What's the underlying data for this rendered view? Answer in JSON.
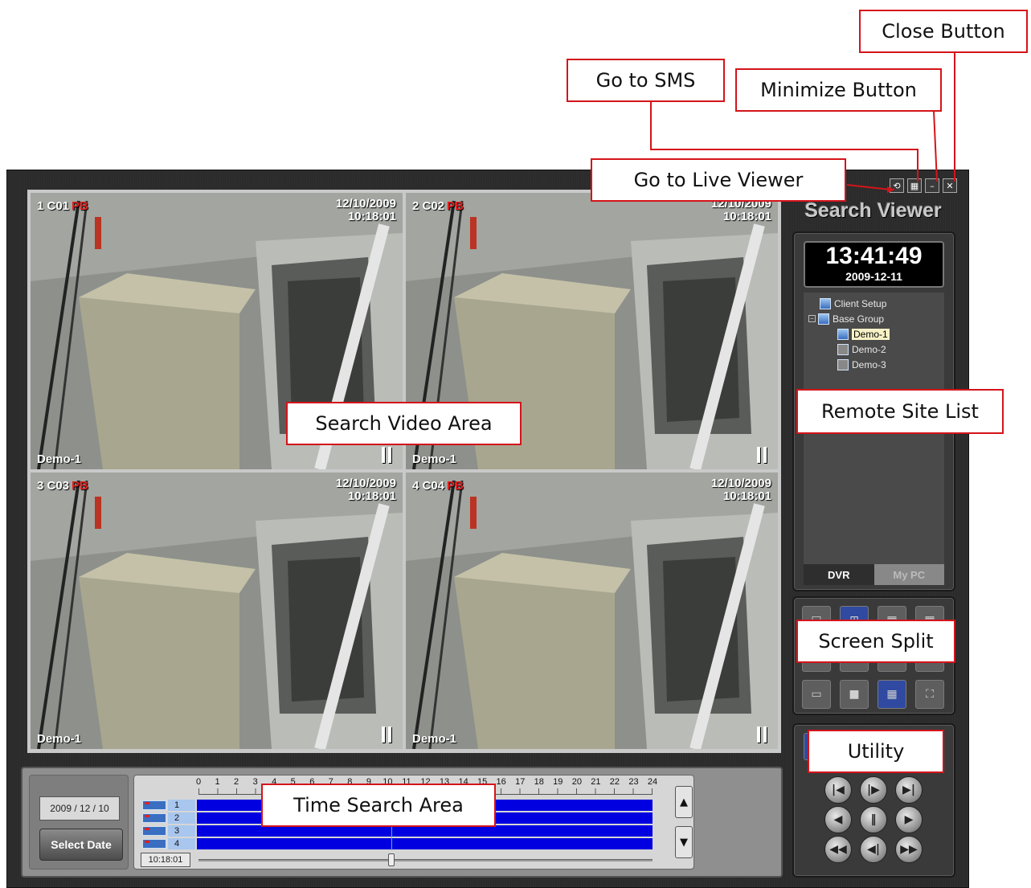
{
  "callouts": {
    "close": "Close Button",
    "sms": "Go to SMS",
    "minimize": "Minimize Button",
    "live": "Go to Live Viewer",
    "video": "Search Video Area",
    "site_list": "Remote Site List",
    "split": "Screen Split",
    "utility": "Utility",
    "time": "Time Search Area"
  },
  "app": {
    "title": "Search Viewer",
    "clock": {
      "time": "13:41:49",
      "date": "2009-12-11"
    },
    "window_buttons": [
      {
        "icon": "live-viewer-icon"
      },
      {
        "icon": "sms-icon"
      },
      {
        "icon": "minimize-icon"
      },
      {
        "icon": "close-icon"
      }
    ]
  },
  "cameras": [
    {
      "num": "1 C01",
      "status": "PB",
      "date": "12/10/2009",
      "time": "10:18:01",
      "site": "Demo-1"
    },
    {
      "num": "2 C02",
      "status": "PB",
      "date": "12/10/2009",
      "time": "10:18:01",
      "site": "Demo-1"
    },
    {
      "num": "3 C03",
      "status": "PB",
      "date": "12/10/2009",
      "time": "10:18:01",
      "site": "Demo-1"
    },
    {
      "num": "4 C04",
      "status": "PB",
      "date": "12/10/2009",
      "time": "10:18:01",
      "site": "Demo-1"
    }
  ],
  "site_tree": [
    {
      "label": "Client Setup"
    },
    {
      "label": "Base Group"
    },
    {
      "label": "Demo-1"
    },
    {
      "label": "Demo-2"
    },
    {
      "label": "Demo-3"
    }
  ],
  "site_tabs": [
    "DVR",
    "My PC"
  ],
  "time_search": {
    "date": "2009 / 12 / 10",
    "select_date": "Select Date",
    "current_time": "10:18:01",
    "hours": [
      "0",
      "1",
      "2",
      "3",
      "4",
      "5",
      "6",
      "7",
      "8",
      "9",
      "10",
      "11",
      "12",
      "13",
      "14",
      "15",
      "16",
      "17",
      "18",
      "19",
      "20",
      "21",
      "22",
      "23",
      "24"
    ],
    "channels": [
      "1",
      "2",
      "3",
      "4"
    ]
  },
  "colors": {
    "callout_border": "#d4141a",
    "selection": "#7b7cf2",
    "timeline_bar": "#0000e0",
    "pb": "#e02020"
  }
}
